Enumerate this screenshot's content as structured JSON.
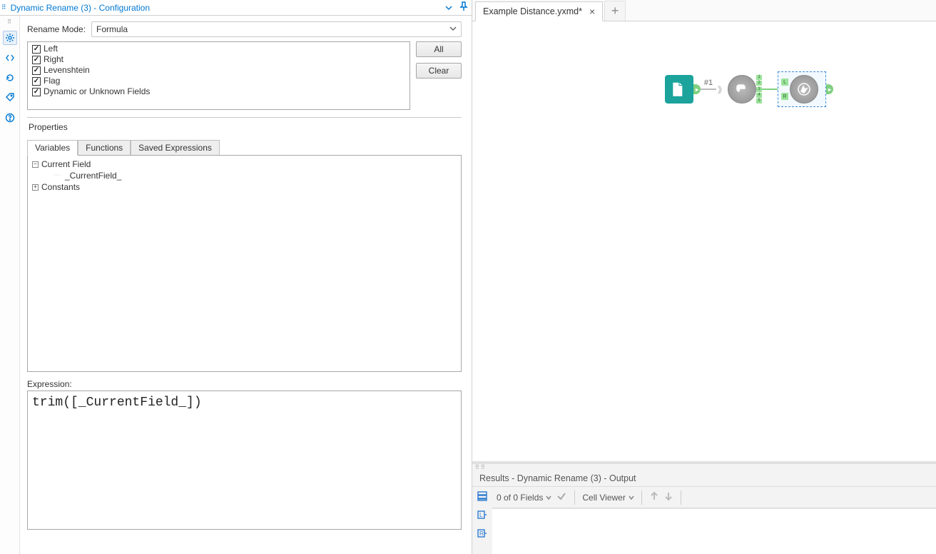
{
  "leftPanel": {
    "title": "Dynamic Rename (3) - Configuration",
    "renameModeLabel": "Rename Mode:",
    "renameModeValue": "Formula",
    "fields": [
      "Left",
      "Right",
      "Levenshtein",
      "Flag",
      "Dynamic or Unknown Fields"
    ],
    "buttons": {
      "all": "All",
      "clear": "Clear"
    },
    "propertiesLabel": "Properties",
    "tabs": {
      "variables": "Variables",
      "functions": "Functions",
      "saved": "Saved Expressions"
    },
    "tree": {
      "currentField": "Current Field",
      "currentFieldLeaf": "_CurrentField_",
      "constants": "Constants"
    },
    "expressionLabel": "Expression:",
    "expressionValue": "trim([_CurrentField_])"
  },
  "tabbar": {
    "fileName": "Example Distance.yxmd*",
    "close": "×",
    "add": "+"
  },
  "workflow": {
    "connLabel": "#1",
    "outNums": [
      "1",
      "2",
      "3",
      "4",
      "5"
    ],
    "anchL": "L",
    "anchR": "R"
  },
  "results": {
    "title": "Results - Dynamic Rename (3) - Output",
    "fieldsText": "0 of 0 Fields",
    "cellViewer": "Cell Viewer"
  }
}
